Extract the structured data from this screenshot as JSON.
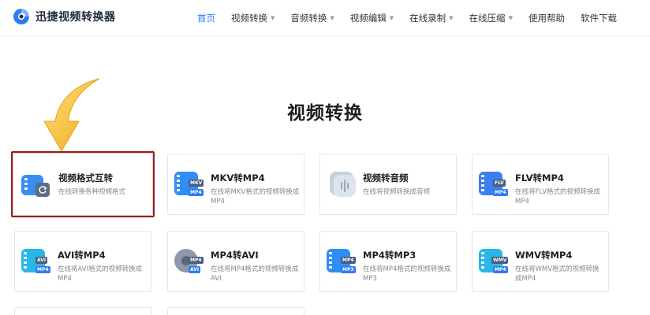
{
  "app": {
    "name": "迅捷视频转换器"
  },
  "nav": [
    {
      "label": "首页",
      "dropdown": false,
      "active": true
    },
    {
      "label": "视频转换",
      "dropdown": true
    },
    {
      "label": "音频转换",
      "dropdown": true
    },
    {
      "label": "视频编辑",
      "dropdown": true
    },
    {
      "label": "在线录制",
      "dropdown": true
    },
    {
      "label": "在线压缩",
      "dropdown": true
    },
    {
      "label": "使用帮助",
      "dropdown": false
    },
    {
      "label": "软件下载",
      "dropdown": false
    }
  ],
  "dropdown_caret": "▼",
  "page_title": "视频转换",
  "cards": [
    {
      "title": "视频格式互转",
      "desc": "在线转换各种视频格式",
      "icon": "video-convert-icon",
      "highlighted": true
    },
    {
      "title": "MKV转MP4",
      "desc": "在线将MKV格式的视频转换成MP4",
      "icon": "mkv-to-mp4-icon",
      "badge_top": "MKV",
      "badge_bottom": "MP4"
    },
    {
      "title": "视频转音频",
      "desc": "在线将视频转换成音频",
      "icon": "video-to-audio-icon"
    },
    {
      "title": "FLV转MP4",
      "desc": "在线将FLV格式的视频转换成MP4",
      "icon": "flv-to-mp4-icon",
      "badge_top": "FLV",
      "badge_bottom": "MP4"
    },
    {
      "title": "AVI转MP4",
      "desc": "在线将AVI格式的视频转换成MP4",
      "icon": "avi-to-mp4-icon",
      "badge_top": "AVI",
      "badge_bottom": "MP4"
    },
    {
      "title": "MP4转AVI",
      "desc": "在线将MP4格式的视频转换成AVI",
      "icon": "mp4-to-avi-icon",
      "badge_top": "MP4",
      "badge_bottom": "AVI"
    },
    {
      "title": "MP4转MP3",
      "desc": "在线将MP4格式的视频转换成MP3",
      "icon": "mp4-to-mp3-icon",
      "badge_top": "MP4",
      "badge_bottom": "MP3"
    },
    {
      "title": "WMV转MP4",
      "desc": "在线将WMV格式的视频转换成MP4",
      "icon": "wmv-to-mp4-icon",
      "badge_top": "WMV",
      "badge_bottom": "MP4"
    }
  ],
  "colors": {
    "accent": "#2f7bf5",
    "highlight_border": "#9b1c1c",
    "arrow": "#f5b731"
  }
}
